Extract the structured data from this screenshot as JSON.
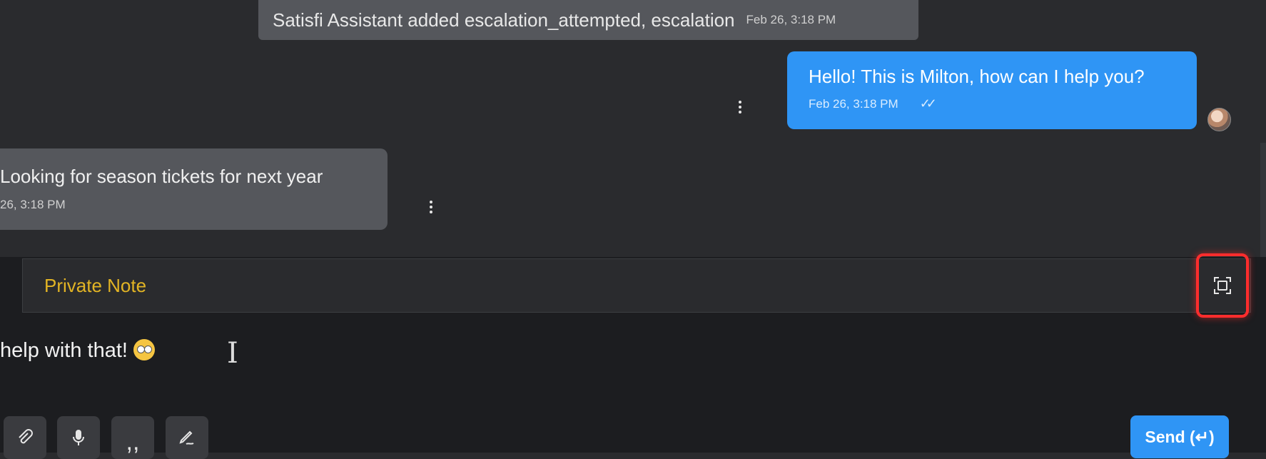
{
  "system_event": {
    "text": "Satisfi Assistant added escalation_attempted, escalation",
    "time": "Feb 26, 3:18 PM"
  },
  "outgoing_message": {
    "text": "Hello! This is Milton, how can I help you?",
    "time": "Feb 26, 3:18 PM",
    "status": "✓✓"
  },
  "incoming_message": {
    "text": "Looking for season tickets for next year",
    "time": "26, 3:18 PM"
  },
  "composer": {
    "mode_label": "Private Note",
    "draft_text": "help with that!",
    "send_label": "Send (↵)"
  },
  "tools": [
    {
      "icon": "paperclip-icon"
    },
    {
      "icon": "microphone-icon"
    },
    {
      "icon": "quote-icon"
    },
    {
      "icon": "signature-icon"
    }
  ],
  "colors": {
    "accent": "#2f95f5",
    "private_note": "#e2b424",
    "highlight": "#ff2d2d"
  }
}
